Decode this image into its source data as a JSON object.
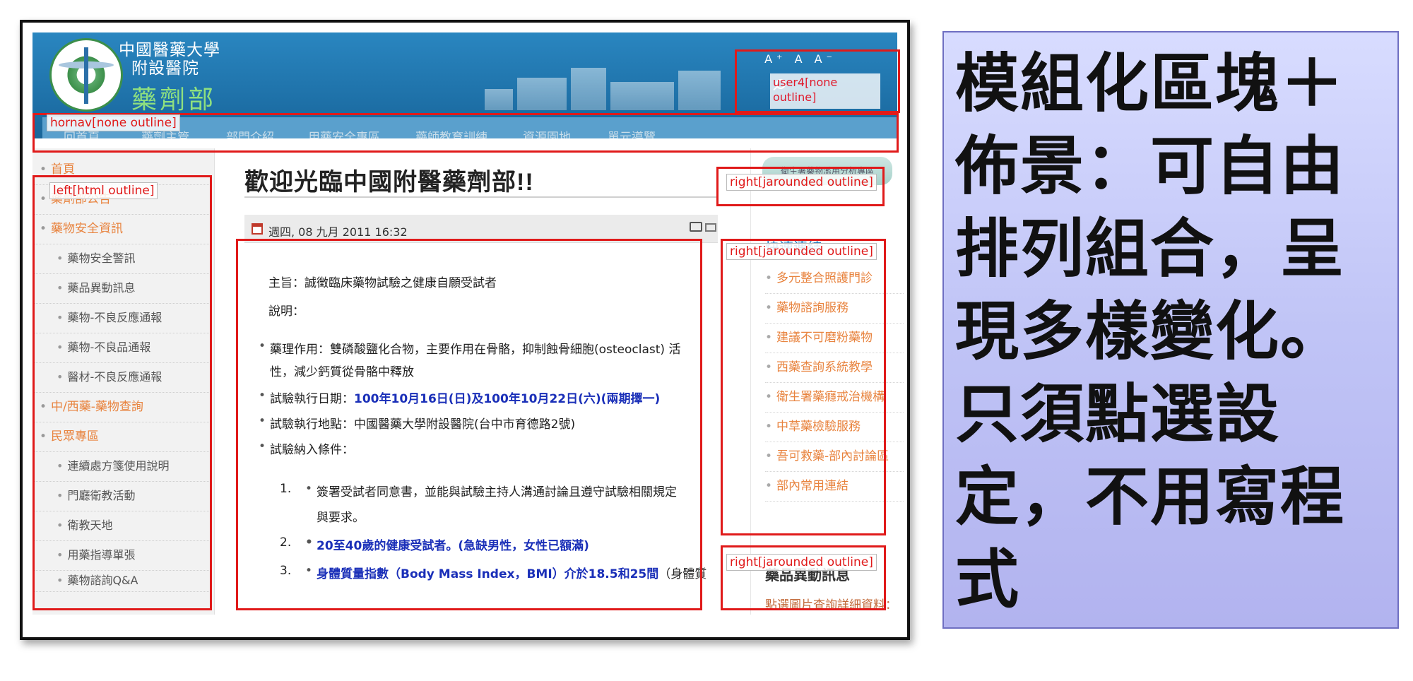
{
  "header": {
    "hospital_line1": "中國醫藥大學",
    "hospital_line2": "附設醫院",
    "department": "藥劑部",
    "font_size_controls": "A⁺ A A⁻",
    "user4_label": "user4[none outline]"
  },
  "hornav": {
    "label": "hornav[none outline]",
    "items": [
      "回首頁",
      "藥劑主管",
      "部門介紹",
      "用藥安全專區",
      "藥師教育訓練",
      "資源園地",
      "單元導覽"
    ]
  },
  "left_sidebar": {
    "label": "left[html outline]",
    "items": [
      {
        "label": "首頁",
        "level": 1
      },
      {
        "label": "藥劑部公告",
        "level": 1
      },
      {
        "label": "藥物安全資訊",
        "level": 1
      },
      {
        "label": "藥物安全警訊",
        "level": 2
      },
      {
        "label": "藥品異動訊息",
        "level": 2
      },
      {
        "label": "藥物-不良反應通報",
        "level": 2
      },
      {
        "label": "藥物-不良品通報",
        "level": 2
      },
      {
        "label": "醫材-不良反應通報",
        "level": 2
      },
      {
        "label": "中/西藥-藥物查詢",
        "level": 1
      },
      {
        "label": "民眾專區",
        "level": 1
      },
      {
        "label": "連續處方箋使用說明",
        "level": 2
      },
      {
        "label": "門廳衛教活動",
        "level": 2
      },
      {
        "label": "衛教天地",
        "level": 2
      },
      {
        "label": "用藥指導單張",
        "level": 2
      },
      {
        "label": "藥物諮詢Q&A",
        "level": 2
      }
    ]
  },
  "main": {
    "page_title": "歡迎光臨中國附醫藥劑部!!",
    "article_date": "週四, 08 九月 2011 16:32",
    "subject": "主旨：誠徵臨床藥物試驗之健康自願受試者",
    "description_label": "說明：",
    "pharmacology_1": "藥理作用：雙磷酸鹽化合物，主要作用在骨骼，抑制蝕骨細胞(osteoclast) 活",
    "pharmacology_2": "性，減少鈣質從骨骼中釋放",
    "exec_date_label": "試驗執行日期：",
    "exec_date_value": "100年10月16日(日)及100年10月22日(六)(兩期擇一)",
    "exec_place": "試驗執行地點：中國醫藥大學附設醫院(台中市育德路2號)",
    "criteria_label": "試驗納入條件：",
    "criteria": [
      {
        "num": "1.",
        "line1": "簽署受試者同意書，並能與試驗主持人溝通討論且遵守試驗相關規定",
        "line2": "與要求。"
      },
      {
        "num": "2.",
        "line1": "20至40歲的健康受試者。(急缺男性，女性已額滿)"
      },
      {
        "num": "3.",
        "line1_blue": "身體質量指數（Body Mass Index，BMI）介於18.5和25間",
        "line1_tail": "（身體質"
      }
    ]
  },
  "right_sidebar": {
    "banner_text": "衛生署藥物濫用分析專區",
    "box1_label": "right[jarounded outline]",
    "box2_label": "right[jarounded outline]",
    "quicklinks_title": "快速連結",
    "links": [
      "多元整合照護門診",
      "藥物諮詢服務",
      "建議不可磨粉藥物",
      "西藥查詢系統教學",
      "衛生署藥癮戒治機構",
      "中草藥檢驗服務",
      "吾可救藥-部內討論區",
      "部內常用連結"
    ],
    "box3_label": "right[jarounded outline]",
    "alert_title": "藥品異動訊息",
    "alert_desc": "點選圖片查詢詳細資料："
  },
  "description": {
    "text": "模組化區塊＋佈景：可自由排列組合，呈現多樣變化。只須點選設定，不用寫程式"
  },
  "colors": {
    "annotation_red": "#e01a1a",
    "banner_blue": "#1d6fa6",
    "link_orange": "#e8833e",
    "emphasis_blue": "#1a2fb8",
    "panel_lavender": "#c0c4f6"
  }
}
